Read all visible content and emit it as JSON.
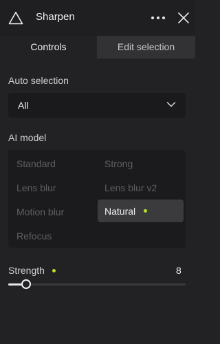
{
  "header": {
    "title": "Sharpen",
    "logo_icon": "triangle-logo",
    "more_icon": "more-dots-icon",
    "close_icon": "close-icon"
  },
  "tabs": [
    {
      "label": "Controls",
      "active": true
    },
    {
      "label": "Edit selection",
      "active": false
    }
  ],
  "auto_selection": {
    "label": "Auto selection",
    "value": "All",
    "icon": "chevron-down-icon"
  },
  "ai_model": {
    "label": "AI model",
    "options": [
      "Standard",
      "Strong",
      "Lens blur",
      "Lens blur v2",
      "Motion blur",
      "Natural",
      "Refocus"
    ],
    "selected": "Natural"
  },
  "strength": {
    "label": "Strength",
    "value": "8",
    "fraction": 0.1
  },
  "colors": {
    "accent_dot": "#b6e02a",
    "background": "#222224",
    "selected_bg": "#3b3b3e"
  }
}
